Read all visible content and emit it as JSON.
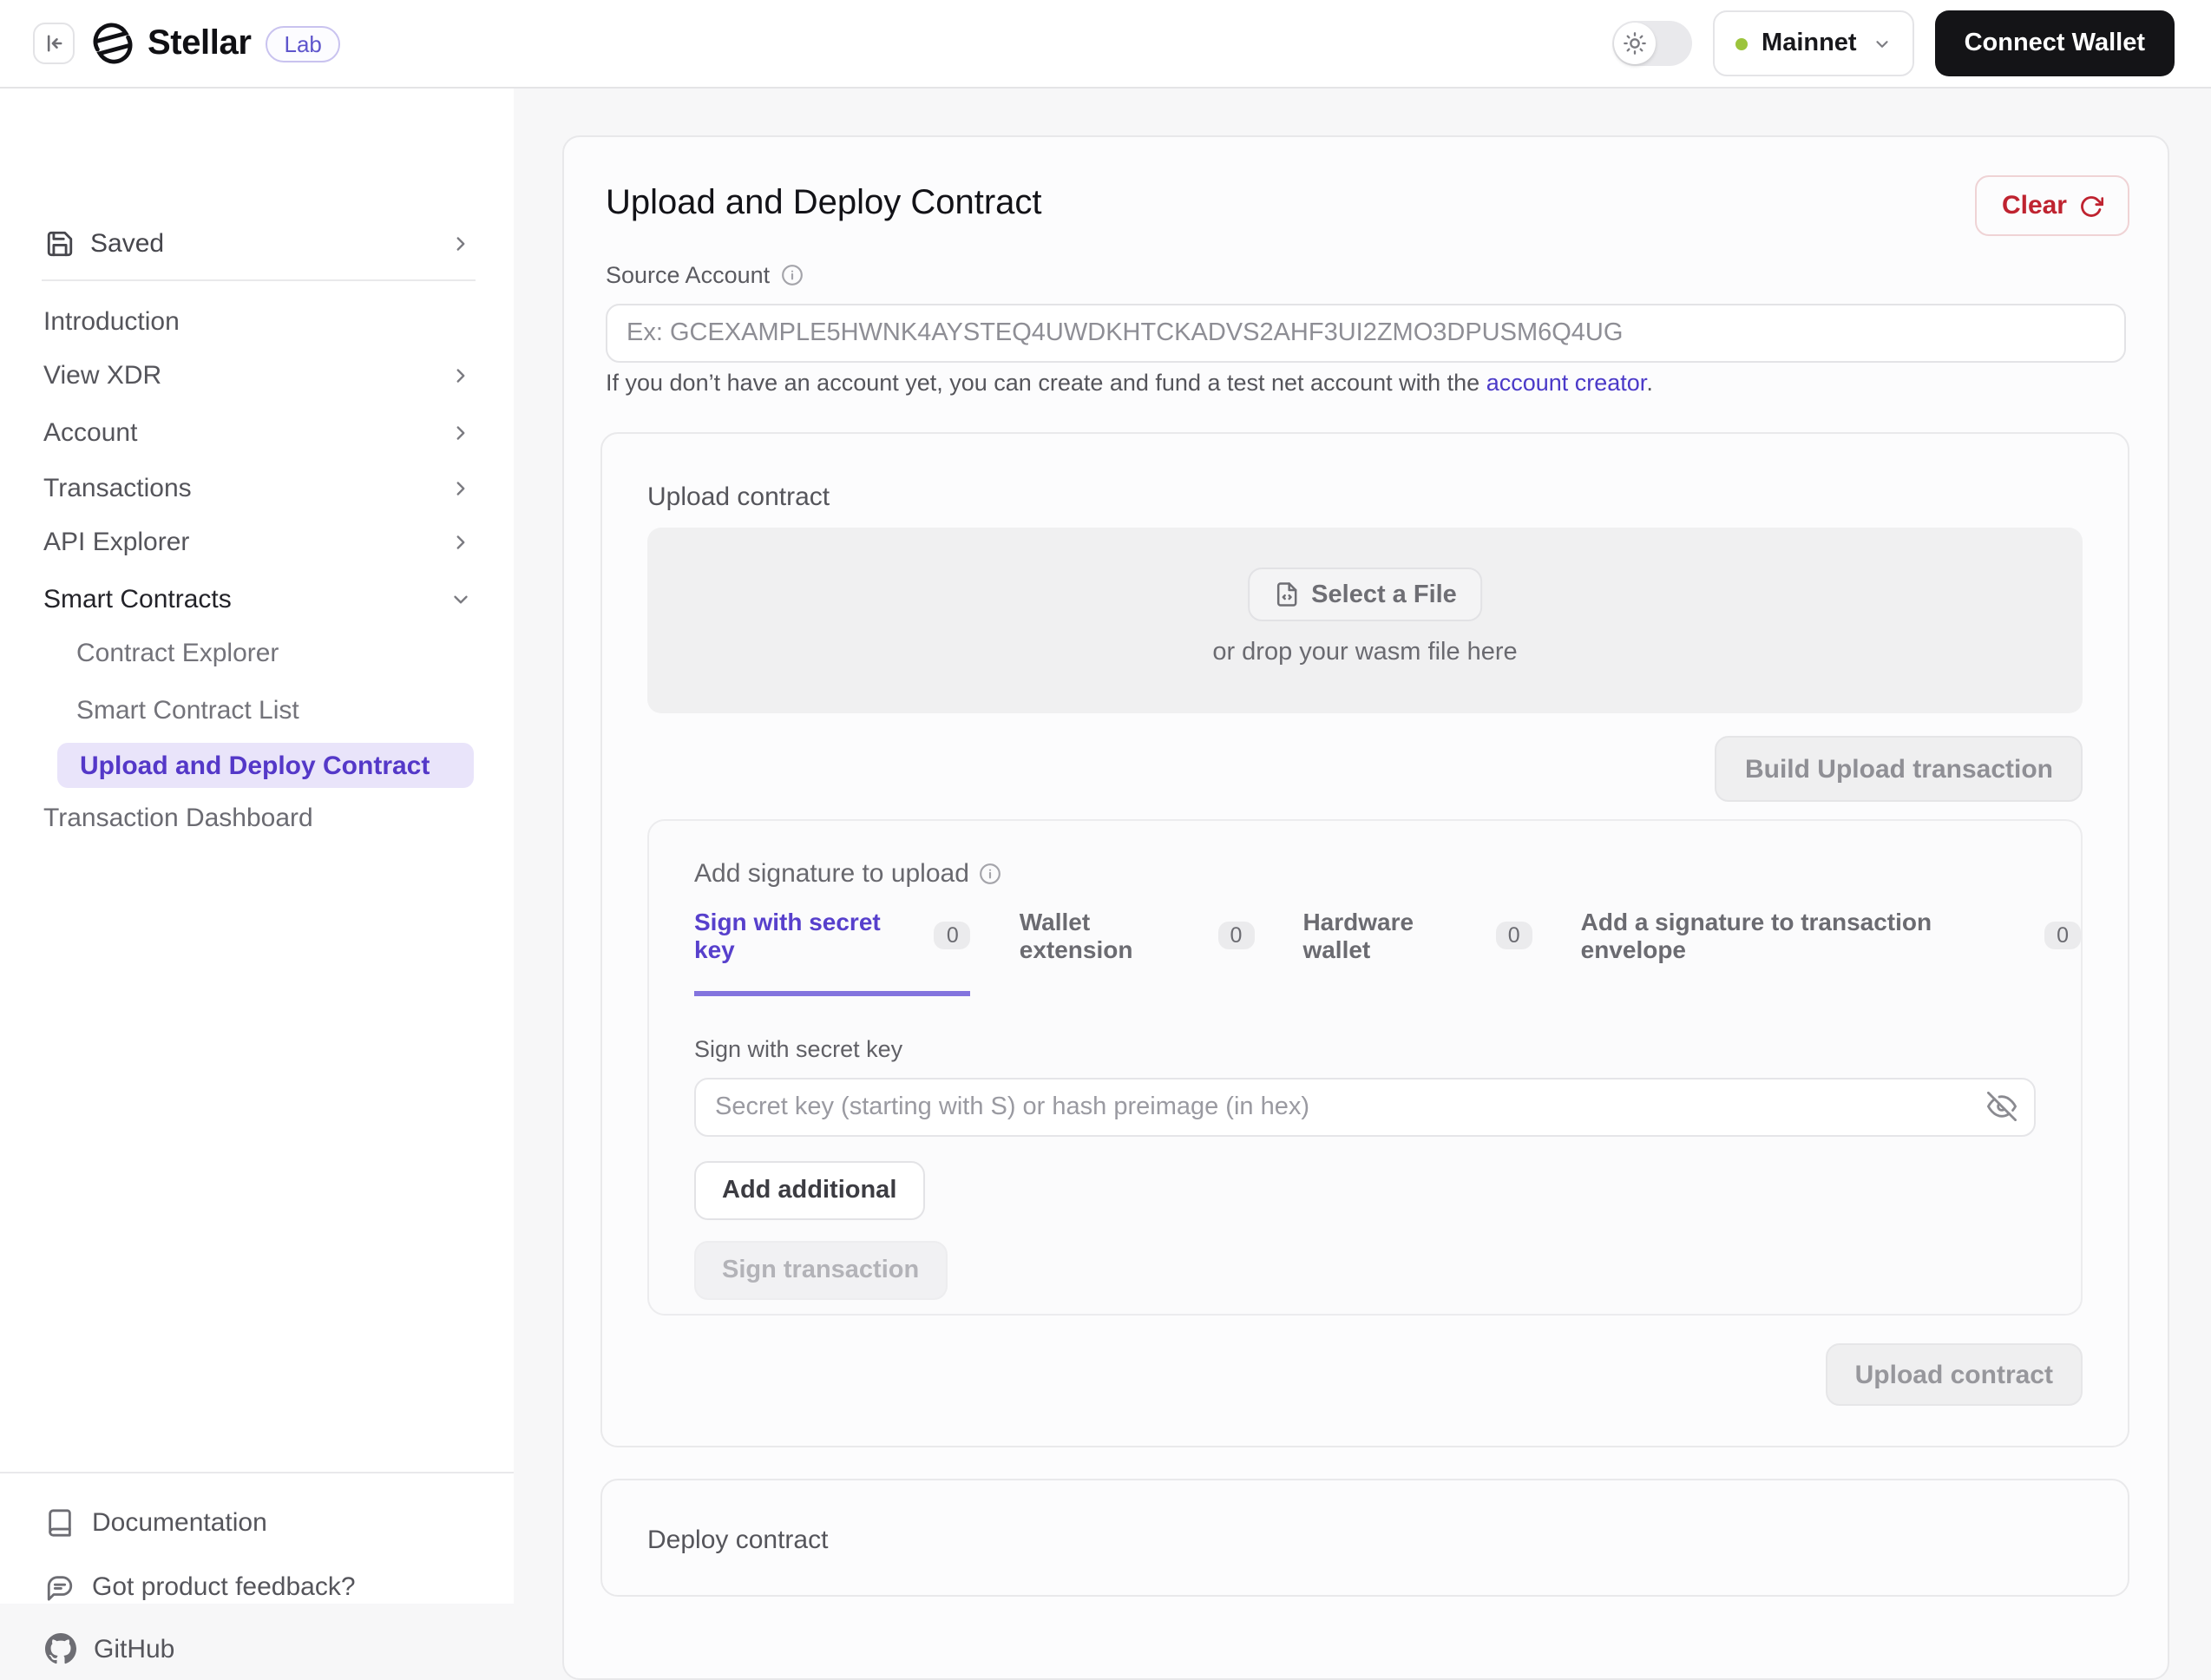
{
  "colors": {
    "purple": "#5740cc",
    "purple_underline": "#8374de",
    "active_pill_bg": "#e9e4fa",
    "green": "#9cc43c",
    "red": "#bf2330",
    "border": "#e4e4e6"
  },
  "header": {
    "brand": "Stellar",
    "badge": "Lab",
    "network_label": "Mainnet",
    "connect_wallet_label": "Connect Wallet"
  },
  "sidebar": {
    "saved_label": "Saved",
    "nav": [
      "Introduction",
      "View XDR",
      "Account",
      "Transactions",
      "API Explorer",
      "Smart Contracts"
    ],
    "sub": [
      "Contract Explorer",
      "Smart Contract List",
      "Upload and Deploy Contract"
    ],
    "dashboard_label": "Transaction Dashboard",
    "footer": [
      "Documentation",
      "Got product feedback?",
      "GitHub"
    ]
  },
  "main": {
    "title": "Upload and Deploy Contract",
    "clear_label": "Clear",
    "source_account": {
      "label": "Source Account",
      "placeholder": "Ex: GCEXAMPLE5HWNK4AYSTEQ4UWDKHTCKADVS2AHF3UI2ZMO3DPUSM6Q4UG",
      "helper_prefix": "If you don’t have an account yet, you can create and fund a test net account with the ",
      "helper_link": "account creator",
      "helper_suffix": "."
    },
    "upload": {
      "heading": "Upload contract",
      "select_file_label": "Select a File",
      "drop_hint": "or drop your wasm file here",
      "build_button_label": "Build Upload transaction",
      "signature": {
        "heading": "Add signature to upload",
        "tabs": [
          {
            "label": "Sign with secret key",
            "count": "0"
          },
          {
            "label": "Wallet extension",
            "count": "0"
          },
          {
            "label": "Hardware wallet",
            "count": "0"
          },
          {
            "label": "Add a signature to transaction envelope",
            "count": "0"
          }
        ],
        "field_label": "Sign with secret key",
        "secret_placeholder": "Secret key (starting with S) or hash preimage (in hex)",
        "add_additional_label": "Add additional",
        "sign_transaction_label": "Sign transaction"
      },
      "upload_button_label": "Upload contract"
    },
    "deploy": {
      "heading": "Deploy contract"
    }
  }
}
